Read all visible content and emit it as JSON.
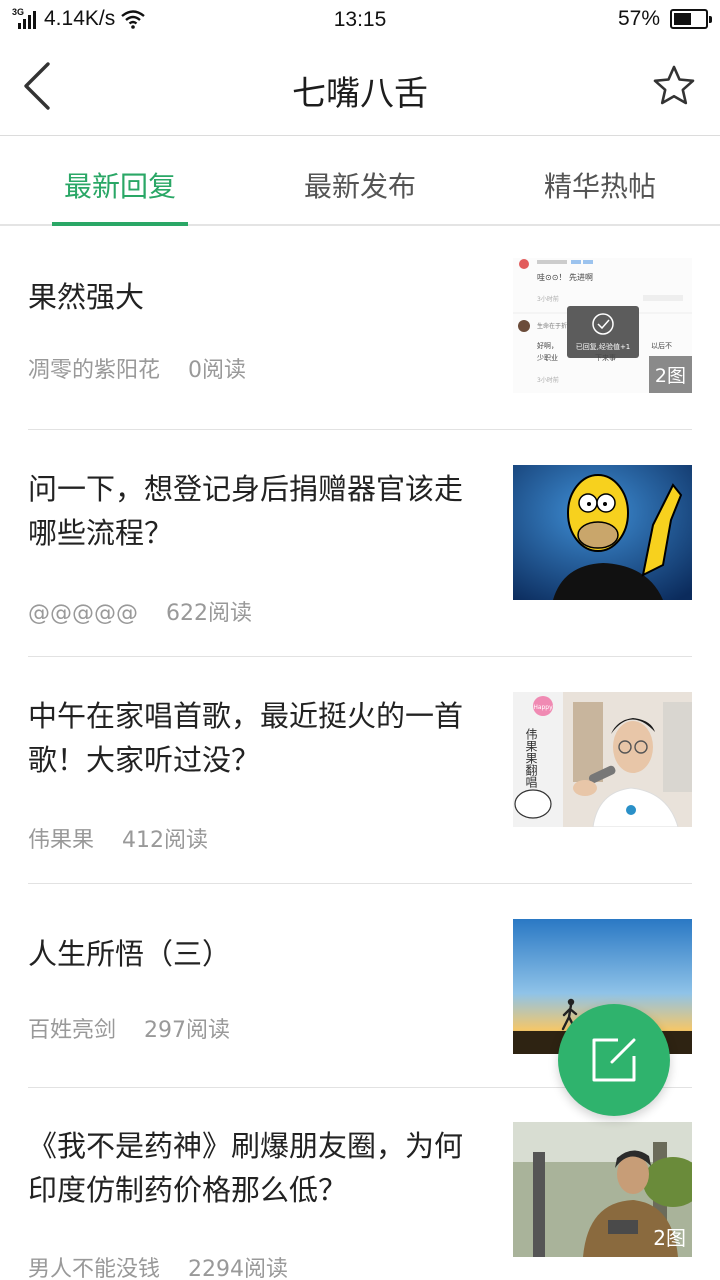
{
  "status_bar": {
    "network": "3G",
    "speed": "4.14K/s",
    "time": "13:15",
    "battery": "57%",
    "battery_level": 0.57
  },
  "header": {
    "title": "七嘴八舌"
  },
  "tabs": [
    {
      "label": "最新回复",
      "active": true
    },
    {
      "label": "最新发布",
      "active": false
    },
    {
      "label": "精华热帖",
      "active": false
    }
  ],
  "posts": [
    {
      "title": "果然强大",
      "author": "凋零的紫阳花",
      "reads": "0阅读",
      "image_count": "2图",
      "thumb_text": {
        "reply_line": "哇⊙⊙！ 先进啊",
        "time1": "3小时前",
        "user2": "生命在于折",
        "comment2": "好啊，",
        "comment2b": "以后不",
        "comment3": "少职业",
        "comment3b": "下来事",
        "time2": "3小时前",
        "toast": "已回复,经验值+1"
      }
    },
    {
      "title": "问一下，想登记身后捐赠器官该走哪些流程？",
      "author": "@@@@@",
      "reads": "622阅读"
    },
    {
      "title": "中午在家唱首歌，最近挺火的一首歌！大家听过没？",
      "author": "伟果果",
      "reads": "412阅读",
      "thumb_text": {
        "sticker": "Happy",
        "vertical": "伟果果翻唱"
      }
    },
    {
      "title": "人生所悟（三）",
      "author": "百姓亮剑",
      "reads": "297阅读"
    },
    {
      "title": "《我不是药神》刷爆朋友圈，为何印度仿制药价格那么低？",
      "author": "男人不能没钱",
      "reads": "2294阅读",
      "image_count": "2图"
    }
  ],
  "colors": {
    "accent": "#2aa766",
    "fab": "#2fb36d",
    "meta_text": "#999999"
  }
}
